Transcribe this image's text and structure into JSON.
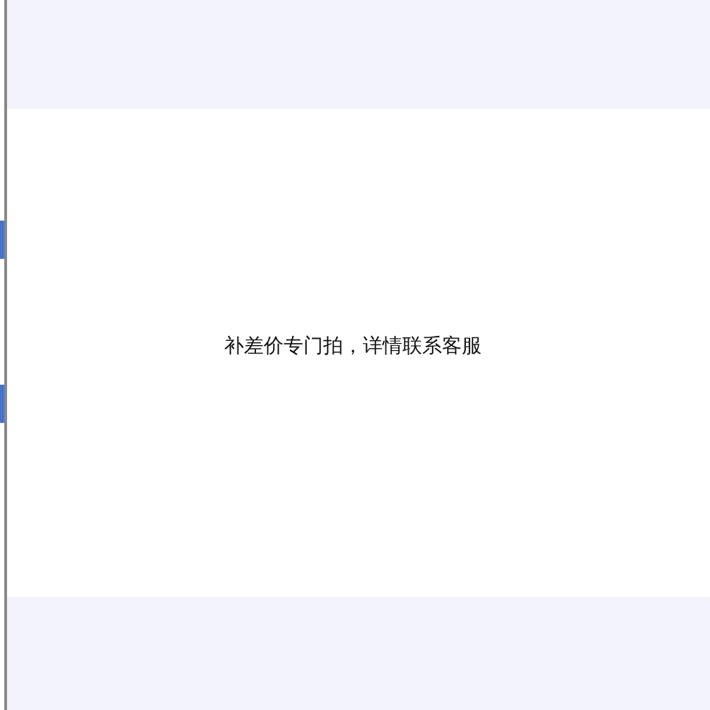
{
  "notice": {
    "text": "补差价专门拍，详情联系客服"
  }
}
